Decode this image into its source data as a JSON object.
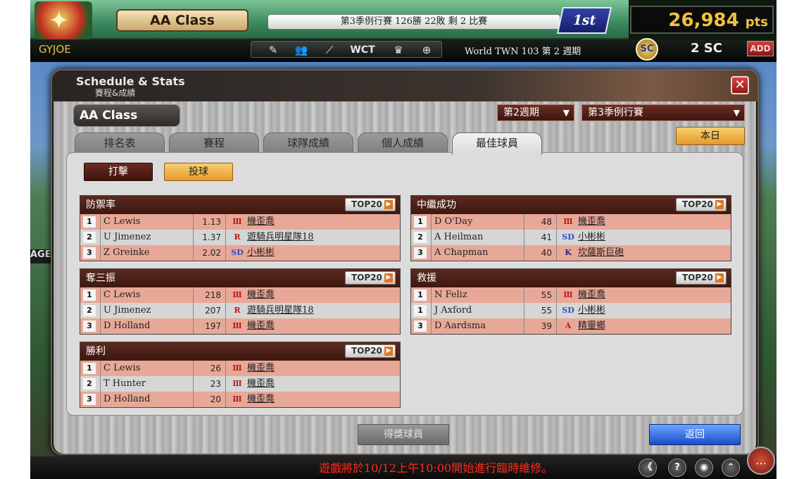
{
  "topbar": {
    "logo_text": "",
    "class_name": "AA Class",
    "season_status": "第3季例行賽  126勝 22敗  剩 2 比賽",
    "rank": "1st",
    "points": "26,984",
    "points_unit": "pts",
    "username": "GYJOE",
    "icons": [
      "pencil-icon",
      "players-icon",
      "bat-icon",
      "wct-icon",
      "trophy-icon",
      "plus-icon"
    ],
    "wct_label": "WCT",
    "world_info": "World TWN 103 第 2 週期",
    "sc_badge": "SC",
    "sc_amount": "2 SC",
    "add_label": "ADD"
  },
  "scene": {
    "left_text": "AGE"
  },
  "panel": {
    "title": "Schedule & Stats",
    "subtitle": "賽程&成績",
    "class_label": "AA Class",
    "week_select": "第2週期",
    "season_select": "第3季例行賽",
    "today_label": "本日",
    "tabs": [
      {
        "label": "排名表"
      },
      {
        "label": "賽程"
      },
      {
        "label": "球隊成績"
      },
      {
        "label": "個人成績"
      },
      {
        "label": "最佳球員"
      }
    ],
    "batting_label": "打擊",
    "pitching_label": "投球",
    "top20_label": "TOP20",
    "winners_label": "得獎球員",
    "back_label": "返回"
  },
  "tables": {
    "era": {
      "title": "防禦率",
      "rows": [
        {
          "rank": "1",
          "name": "C Lewis",
          "value": "1.13",
          "team": "機歪喬",
          "team_icon": "Ⅲ"
        },
        {
          "rank": "2",
          "name": "U Jimenez",
          "value": "1.37",
          "team": "遊騎兵明星隊18",
          "team_icon": "R"
        },
        {
          "rank": "3",
          "name": "Z Greinke",
          "value": "2.02",
          "team": "小彬彬",
          "team_icon": "SD"
        }
      ]
    },
    "holds": {
      "title": "中繼成功",
      "rows": [
        {
          "rank": "1",
          "name": "D O'Day",
          "value": "48",
          "team": "機歪喬",
          "team_icon": "Ⅲ"
        },
        {
          "rank": "2",
          "name": "A Heilman",
          "value": "41",
          "team": "小彬彬",
          "team_icon": "SD"
        },
        {
          "rank": "3",
          "name": "A Chapman",
          "value": "40",
          "team": "坎薩斯巨砲",
          "team_icon": "K"
        }
      ]
    },
    "strikeouts": {
      "title": "奪三振",
      "rows": [
        {
          "rank": "1",
          "name": "C Lewis",
          "value": "218",
          "team": "機歪喬",
          "team_icon": "Ⅲ"
        },
        {
          "rank": "2",
          "name": "U Jimenez",
          "value": "207",
          "team": "遊騎兵明星隊18",
          "team_icon": "R"
        },
        {
          "rank": "3",
          "name": "D Holland",
          "value": "197",
          "team": "機歪喬",
          "team_icon": "Ⅲ"
        }
      ]
    },
    "saves": {
      "title": "救援",
      "rows": [
        {
          "rank": "1",
          "name": "N Feliz",
          "value": "55",
          "team": "機歪喬",
          "team_icon": "Ⅲ"
        },
        {
          "rank": "1",
          "name": "J Axford",
          "value": "55",
          "team": "小彬彬",
          "team_icon": "SD"
        },
        {
          "rank": "3",
          "name": "D Aardsma",
          "value": "39",
          "team": "精靈鄉",
          "team_icon": "A"
        }
      ]
    },
    "wins": {
      "title": "勝利",
      "rows": [
        {
          "rank": "1",
          "name": "C Lewis",
          "value": "26",
          "team": "機歪喬",
          "team_icon": "Ⅲ"
        },
        {
          "rank": "2",
          "name": "T Hunter",
          "value": "23",
          "team": "機歪喬",
          "team_icon": "Ⅲ"
        },
        {
          "rank": "3",
          "name": "D Holland",
          "value": "20",
          "team": "機歪喬",
          "team_icon": "Ⅲ"
        }
      ]
    }
  },
  "bottom": {
    "maintenance": "遊戲將於10/12上午10:00開始進行臨時維修。",
    "buttons": [
      "collapse-icon",
      "help-icon",
      "sound-icon",
      "menu-icon"
    ],
    "button_glyphs": [
      "《",
      "?",
      "◉",
      "⌃"
    ],
    "chat_glyph": "…"
  },
  "colors": {
    "accent_orange": "#e59a2a",
    "row_highlight": "#e8a898",
    "header_brown": "#5a2a20",
    "back_blue": "#1c4cc8",
    "maintenance_red": "#ff2a1a"
  }
}
